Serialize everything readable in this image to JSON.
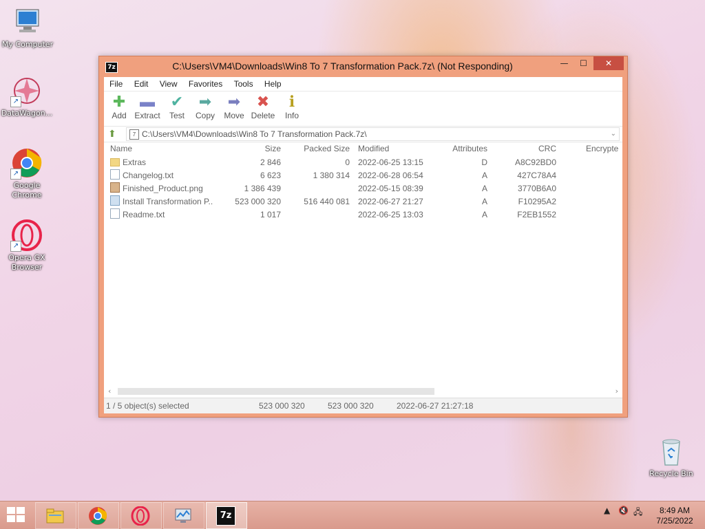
{
  "desktop": {
    "icons": [
      {
        "label": "My Computer"
      },
      {
        "label": "DataWagon..."
      },
      {
        "label": "Google Chrome"
      },
      {
        "label": "Opera GX Browser"
      },
      {
        "label": "Recycle Bin"
      }
    ]
  },
  "window": {
    "app_icon_text": "7z",
    "title": "C:\\Users\\VM4\\Downloads\\Win8 To 7 Transformation Pack.7z\\ (Not Responding)",
    "controls": {
      "minimize": "—",
      "maximize": "☐",
      "close": "✕"
    }
  },
  "menu": [
    "File",
    "Edit",
    "View",
    "Favorites",
    "Tools",
    "Help"
  ],
  "toolbar": [
    {
      "label": "Add",
      "icon": "plus-icon",
      "glyph": "✚",
      "color": "#5cb85c"
    },
    {
      "label": "Extract",
      "icon": "minus-icon",
      "glyph": "▬",
      "color": "#7a82c8"
    },
    {
      "label": "Test",
      "icon": "check-icon",
      "glyph": "✔",
      "color": "#4fb3a0"
    },
    {
      "label": "Copy",
      "icon": "arrow-right-icon",
      "glyph": "➡",
      "color": "#5aa9a0"
    },
    {
      "label": "Move",
      "icon": "arrow-right-icon",
      "glyph": "➡",
      "color": "#7a7fbf"
    },
    {
      "label": "Delete",
      "icon": "x-icon",
      "glyph": "✖",
      "color": "#d9534f"
    },
    {
      "label": "Info",
      "icon": "info-icon",
      "glyph": "ℹ",
      "color": "#b8a020"
    }
  ],
  "address": {
    "path": "C:\\Users\\VM4\\Downloads\\Win8 To 7 Transformation Pack.7z\\"
  },
  "columns": {
    "name": "Name",
    "size": "Size",
    "packed": "Packed Size",
    "modified": "Modified",
    "attributes": "Attributes",
    "crc": "CRC",
    "encrypted": "Encrypte"
  },
  "files": [
    {
      "name": "Extras",
      "type": "folder",
      "size": "2 846",
      "packed": "0",
      "modified": "2022-06-25 13:15",
      "attr": "D",
      "crc": "A8C92BD0"
    },
    {
      "name": "Changelog.txt",
      "type": "doc",
      "size": "6 623",
      "packed": "1 380 314",
      "modified": "2022-06-28 06:54",
      "attr": "A",
      "crc": "427C78A4"
    },
    {
      "name": "Finished_Product.png",
      "type": "img",
      "size": "1 386 439",
      "packed": "",
      "modified": "2022-05-15 08:39",
      "attr": "A",
      "crc": "3770B6A0"
    },
    {
      "name": "Install Transformation P...",
      "type": "exe",
      "size": "523 000 320",
      "packed": "516 440 081",
      "modified": "2022-06-27 21:27",
      "attr": "A",
      "crc": "F10295A2"
    },
    {
      "name": "Readme.txt",
      "type": "doc",
      "size": "1 017",
      "packed": "",
      "modified": "2022-06-25 13:03",
      "attr": "A",
      "crc": "F2EB1552"
    }
  ],
  "status": {
    "selection": "1 / 5 object(s) selected",
    "size": "523 000 320",
    "packed": "523 000 320",
    "modified": "2022-06-27 21:27:18"
  },
  "taskbar": {
    "apps": [
      {
        "name": "file-explorer"
      },
      {
        "name": "chrome"
      },
      {
        "name": "opera"
      },
      {
        "name": "task-monitor"
      },
      {
        "name": "7zip",
        "label": "7z",
        "active": true
      }
    ],
    "clock": {
      "time": "8:49 AM",
      "date": "7/25/2022"
    }
  }
}
